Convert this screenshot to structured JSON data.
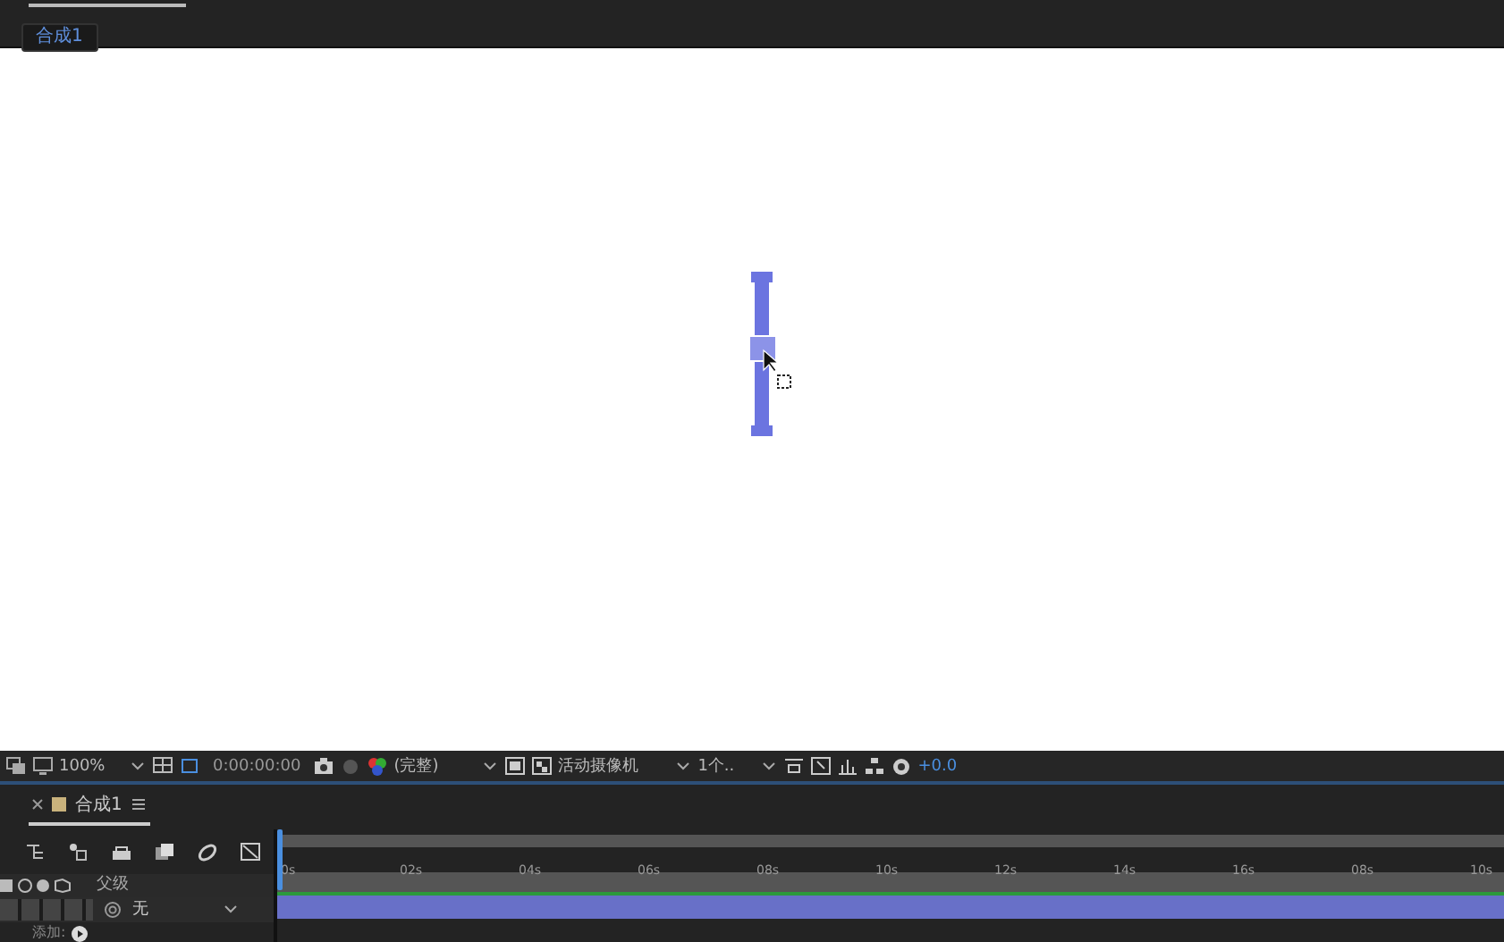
{
  "comp_tab": {
    "label": "合成1"
  },
  "viewer_toolbar": {
    "zoom": "100%",
    "timecode": "0:00:00:00",
    "resolution": "(完整)",
    "camera": "活动摄像机",
    "views": "1个..",
    "exposure": "+0.0"
  },
  "timeline": {
    "tab": {
      "label": "合成1"
    },
    "ruler": [
      "0s",
      "02s",
      "04s",
      "06s",
      "08s",
      "10s",
      "12s",
      "14s",
      "16s",
      "08s",
      "10s"
    ],
    "parent_header": "父级",
    "layers": [
      {
        "parent": "无"
      }
    ],
    "add_label": "添加:"
  }
}
